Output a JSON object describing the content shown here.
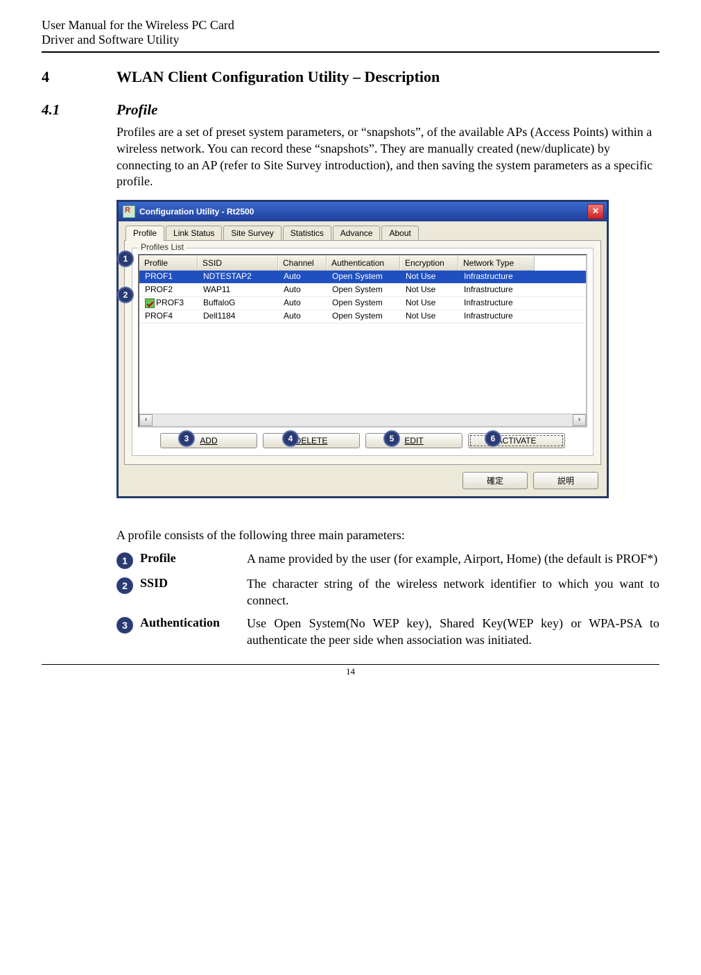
{
  "doc_header": {
    "line1": "User Manual for the Wireless PC Card",
    "line2": "Driver and Software Utility"
  },
  "section": {
    "num": "4",
    "title": "WLAN Client Configuration Utility – Description"
  },
  "subsection": {
    "num": "4.1",
    "title": "Profile"
  },
  "paragraph1": "Profiles are a set of preset system parameters, or “snapshots”, of the available APs (Access Points) within a wireless network. You can record these “snapshots”. They are manually created (new/duplicate) by connecting to an AP (refer to Site Survey introduction), and then saving the system parameters as a specific profile.",
  "paragraph2": "A profile consists of the following three main parameters:",
  "params": [
    {
      "n": "1",
      "label": "Profile",
      "desc": "A name provided by the user (for example, Airport, Home) (the default is PROF*)"
    },
    {
      "n": "2",
      "label": "SSID",
      "desc": "The character string of the wireless network identifier to which you want to connect."
    },
    {
      "n": "3",
      "label": "Authentication",
      "desc": "Use Open System(No WEP key), Shared Key(WEP key) or WPA-PSA to authenticate the peer side when association was initiated."
    }
  ],
  "page_number": "14",
  "screenshot": {
    "title": "Configuration Utility - Rt2500",
    "close_glyph": "✕",
    "tabs": [
      "Profile",
      "Link Status",
      "Site Survey",
      "Statistics",
      "Advance",
      "About"
    ],
    "active_tab_index": 0,
    "fieldset_label": "Profiles List",
    "columns": [
      "Profile",
      "SSID",
      "Channel",
      "Authentication",
      "Encryption",
      "Network Type"
    ],
    "rows": [
      {
        "selected": true,
        "checked": false,
        "cells": [
          "PROF1",
          "NDTESTAP2",
          "Auto",
          "Open System",
          "Not Use",
          "Infrastructure"
        ]
      },
      {
        "selected": false,
        "checked": false,
        "cells": [
          "PROF2",
          "WAP11",
          "Auto",
          "Open System",
          "Not Use",
          "Infrastructure"
        ]
      },
      {
        "selected": false,
        "checked": true,
        "cells": [
          "PROF3",
          "BuffaloG",
          "Auto",
          "Open System",
          "Not Use",
          "Infrastructure"
        ]
      },
      {
        "selected": false,
        "checked": false,
        "cells": [
          "PROF4",
          "Dell1184",
          "Auto",
          "Open System",
          "Not Use",
          "Infrastructure"
        ]
      }
    ],
    "scroll_left": "‹",
    "scroll_right": "›",
    "buttons": {
      "add": "ADD",
      "delete": "DELETE",
      "edit": "EDIT",
      "activate": "ACTIVATE"
    },
    "bottom": {
      "ok": "確定",
      "help": "説明"
    },
    "callouts": {
      "c1": "1",
      "c2": "2",
      "c3": "3",
      "c4": "4",
      "c5": "5",
      "c6": "6"
    }
  }
}
